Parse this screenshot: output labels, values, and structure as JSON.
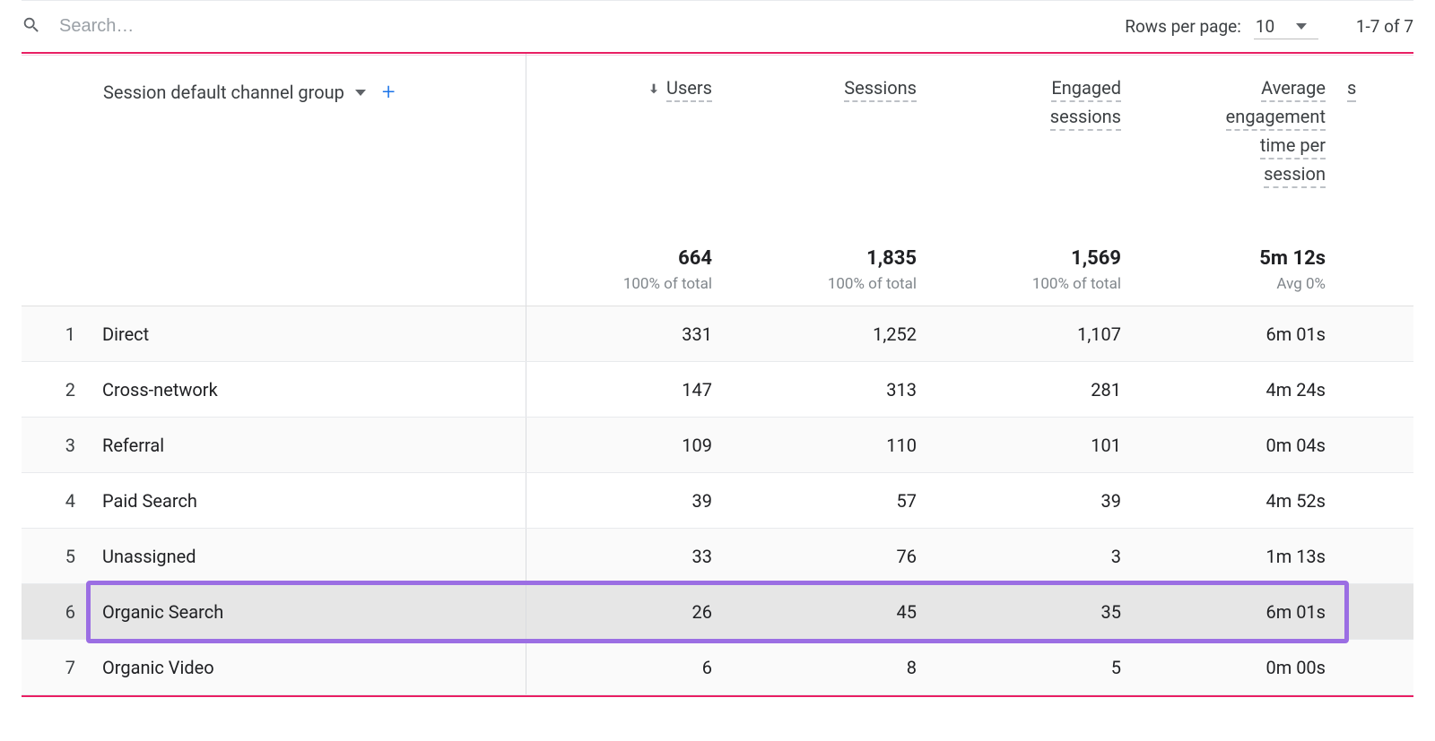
{
  "search": {
    "placeholder": "Search…"
  },
  "pagination": {
    "rows_label": "Rows per page:",
    "rows_value": "10",
    "range_label": "1-7 of 7"
  },
  "dimension": {
    "label": "Session default channel group"
  },
  "columns": [
    {
      "label": "Users",
      "sorted": true
    },
    {
      "label": "Sessions",
      "sorted": false
    },
    {
      "label": "Engaged sessions",
      "sorted": false,
      "lines": [
        "Engaged",
        "sessions"
      ]
    },
    {
      "label": "Average engagement time per session",
      "sorted": false,
      "lines": [
        "Average",
        "engagement",
        "time per",
        "session"
      ]
    }
  ],
  "edge_column_hint": "s",
  "totals": {
    "users": {
      "value": "664",
      "sub": "100% of total"
    },
    "sessions": {
      "value": "1,835",
      "sub": "100% of total"
    },
    "engaged": {
      "value": "1,569",
      "sub": "100% of total"
    },
    "avg": {
      "value": "5m 12s",
      "sub": "Avg 0%"
    }
  },
  "rows": [
    {
      "idx": "1",
      "name": "Direct",
      "users": "331",
      "sessions": "1,252",
      "engaged": "1,107",
      "avg": "6m 01s",
      "highlight": false
    },
    {
      "idx": "2",
      "name": "Cross-network",
      "users": "147",
      "sessions": "313",
      "engaged": "281",
      "avg": "4m 24s",
      "highlight": false
    },
    {
      "idx": "3",
      "name": "Referral",
      "users": "109",
      "sessions": "110",
      "engaged": "101",
      "avg": "0m 04s",
      "highlight": false
    },
    {
      "idx": "4",
      "name": "Paid Search",
      "users": "39",
      "sessions": "57",
      "engaged": "39",
      "avg": "4m 52s",
      "highlight": false
    },
    {
      "idx": "5",
      "name": "Unassigned",
      "users": "33",
      "sessions": "76",
      "engaged": "3",
      "avg": "1m 13s",
      "highlight": false
    },
    {
      "idx": "6",
      "name": "Organic Search",
      "users": "26",
      "sessions": "45",
      "engaged": "35",
      "avg": "6m 01s",
      "highlight": true
    },
    {
      "idx": "7",
      "name": "Organic Video",
      "users": "6",
      "sessions": "8",
      "engaged": "5",
      "avg": "0m 00s",
      "highlight": false
    }
  ],
  "chart_data": {
    "type": "table",
    "dimension": "Session default channel group",
    "metrics": [
      "Users",
      "Sessions",
      "Engaged sessions",
      "Average engagement time per session"
    ],
    "totals": {
      "Users": 664,
      "Sessions": 1835,
      "Engaged sessions": 1569,
      "Average engagement time per session": "5m 12s"
    },
    "rows": [
      {
        "channel": "Direct",
        "Users": 331,
        "Sessions": 1252,
        "Engaged sessions": 1107,
        "Avg engagement time": "6m 01s"
      },
      {
        "channel": "Cross-network",
        "Users": 147,
        "Sessions": 313,
        "Engaged sessions": 281,
        "Avg engagement time": "4m 24s"
      },
      {
        "channel": "Referral",
        "Users": 109,
        "Sessions": 110,
        "Engaged sessions": 101,
        "Avg engagement time": "0m 04s"
      },
      {
        "channel": "Paid Search",
        "Users": 39,
        "Sessions": 57,
        "Engaged sessions": 39,
        "Avg engagement time": "4m 52s"
      },
      {
        "channel": "Unassigned",
        "Users": 33,
        "Sessions": 76,
        "Engaged sessions": 3,
        "Avg engagement time": "1m 13s"
      },
      {
        "channel": "Organic Search",
        "Users": 26,
        "Sessions": 45,
        "Engaged sessions": 35,
        "Avg engagement time": "6m 01s"
      },
      {
        "channel": "Organic Video",
        "Users": 6,
        "Sessions": 8,
        "Engaged sessions": 5,
        "Avg engagement time": "0m 00s"
      }
    ]
  }
}
